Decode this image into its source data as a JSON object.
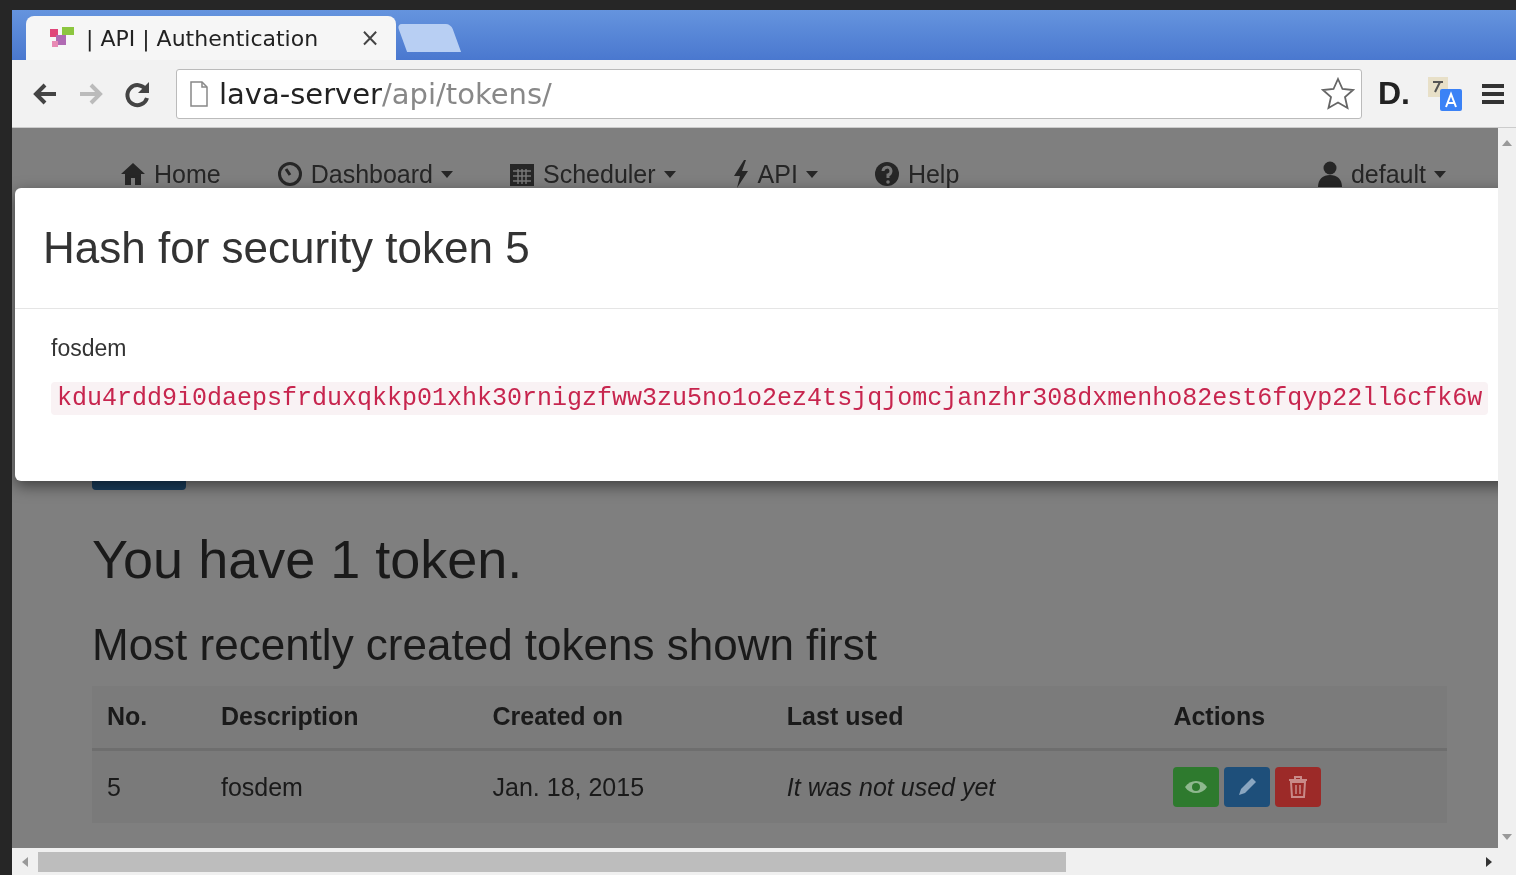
{
  "browser": {
    "tab": {
      "title": "| API | Authentication",
      "close": "×",
      "selected": true
    },
    "address": {
      "host": "lava-server",
      "path": "/api/tokens/"
    },
    "extension_label": "D."
  },
  "navbar": {
    "items": [
      {
        "label": "Home",
        "kind": "home",
        "dropdown": false
      },
      {
        "label": "Dashboard",
        "kind": "dashboard",
        "dropdown": true
      },
      {
        "label": "Scheduler",
        "kind": "scheduler",
        "dropdown": true
      },
      {
        "label": "API",
        "kind": "api",
        "dropdown": true
      },
      {
        "label": "Help",
        "kind": "help",
        "dropdown": false
      }
    ],
    "user": {
      "label": "default",
      "dropdown": true
    }
  },
  "heading": "You have 1 token.",
  "subheading": "Most recently created tokens shown first",
  "table": {
    "columns": [
      "No.",
      "Description",
      "Created on",
      "Last used",
      "Actions"
    ],
    "rows": [
      {
        "number": "5",
        "description": "fosdem",
        "created_on": "Jan. 18, 2015",
        "last_used": "It was not used yet",
        "actions": [
          {
            "kind": "view"
          },
          {
            "kind": "edit"
          },
          {
            "kind": "delete"
          }
        ]
      }
    ]
  },
  "modal": {
    "title": "Hash for security token 5",
    "description": "fosdem",
    "hash": "kdu4rdd9i0daepsfrduxqkkp01xhk30rnigzfww3zu5no1o2ez4tsjqjomcjanzhr308dxmenho82est6fqyp22ll6cfk6w"
  }
}
